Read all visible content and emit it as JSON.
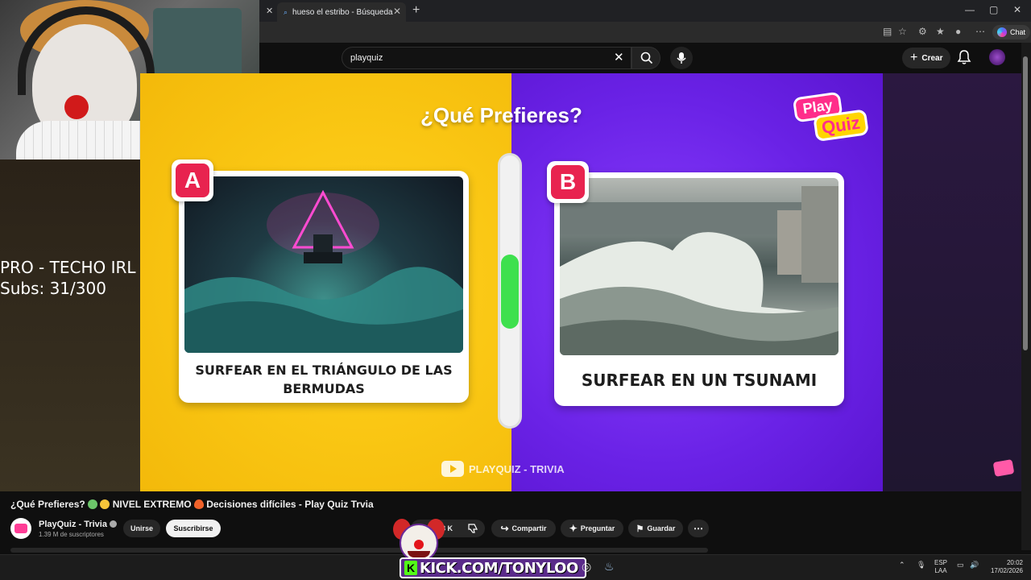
{
  "browser": {
    "tabs": [
      {
        "label": "hueso el estribo - Búsqueda",
        "active": true
      }
    ],
    "chat_label": "Chat",
    "window_controls": [
      "—",
      "▢",
      "✕"
    ]
  },
  "youtube": {
    "search": {
      "value": "playquiz"
    },
    "create_label": "Crear"
  },
  "overlay": {
    "line1": "PRO - TECHO IRL",
    "line2": "Subs: 31/300"
  },
  "video": {
    "question_title": "¿Qué Prefieres?",
    "logo_line1": "Play",
    "logo_line2": "Quiz",
    "option_a": {
      "badge": "A",
      "label": "SURFEAR EN EL TRIÁNGULO DE LAS BERMUDAS"
    },
    "option_b": {
      "badge": "B",
      "label": "SURFEAR EN UN TSUNAMI"
    },
    "watermark": "PLAYQUIZ - TRIVIA",
    "colors": {
      "left": "#f9c512",
      "right": "#6a22e6",
      "badge": "#e8234f",
      "progress": "#3ee04e"
    }
  },
  "details": {
    "title_part1": "¿Qué Prefieres?",
    "title_part2": "NIVEL EXTREMO",
    "title_part3": "Decisiones difíciles - Play Quiz Trvia",
    "channel_name": "PlayQuiz - Trivia",
    "subscribers": "1.39 M de suscriptores",
    "join_label": "Unirse",
    "subscribe_label": "Suscribirse",
    "like_count": "8 K",
    "share_label": "Compartir",
    "ask_label": "Preguntar",
    "save_label": "Guardar"
  },
  "kick": {
    "k_letter": "K",
    "text": "KICK.COM/TONYLOO"
  },
  "taskbar": {
    "lang_line1": "ESP",
    "lang_line2": "LAA",
    "time": "20:02",
    "date": "17/02/2026"
  }
}
